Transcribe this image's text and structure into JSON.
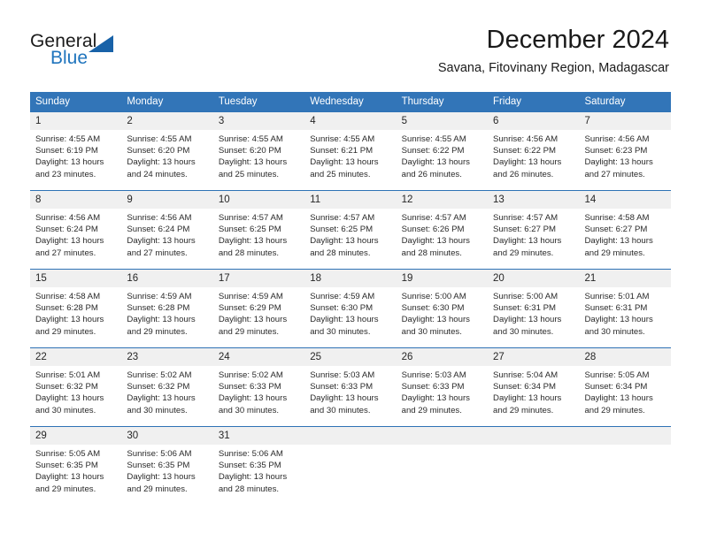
{
  "brand": {
    "name_part1": "General",
    "name_part2": "Blue",
    "triangle_color": "#1862a8",
    "blue_color": "#1f74bd"
  },
  "header": {
    "title": "December 2024",
    "subtitle": "Savana, Fitovinany Region, Madagascar"
  },
  "theme": {
    "header_blue": "#3275b8",
    "row_divider_blue": "#2e72b5",
    "date_band_gray": "#f0f0f0"
  },
  "weekdays": [
    "Sunday",
    "Monday",
    "Tuesday",
    "Wednesday",
    "Thursday",
    "Friday",
    "Saturday"
  ],
  "weeks": [
    {
      "dates": [
        "1",
        "2",
        "3",
        "4",
        "5",
        "6",
        "7"
      ],
      "cells": [
        {
          "sunrise": "Sunrise: 4:55 AM",
          "sunset": "Sunset: 6:19 PM",
          "daylight": "Daylight: 13 hours and 23 minutes."
        },
        {
          "sunrise": "Sunrise: 4:55 AM",
          "sunset": "Sunset: 6:20 PM",
          "daylight": "Daylight: 13 hours and 24 minutes."
        },
        {
          "sunrise": "Sunrise: 4:55 AM",
          "sunset": "Sunset: 6:20 PM",
          "daylight": "Daylight: 13 hours and 25 minutes."
        },
        {
          "sunrise": "Sunrise: 4:55 AM",
          "sunset": "Sunset: 6:21 PM",
          "daylight": "Daylight: 13 hours and 25 minutes."
        },
        {
          "sunrise": "Sunrise: 4:55 AM",
          "sunset": "Sunset: 6:22 PM",
          "daylight": "Daylight: 13 hours and 26 minutes."
        },
        {
          "sunrise": "Sunrise: 4:56 AM",
          "sunset": "Sunset: 6:22 PM",
          "daylight": "Daylight: 13 hours and 26 minutes."
        },
        {
          "sunrise": "Sunrise: 4:56 AM",
          "sunset": "Sunset: 6:23 PM",
          "daylight": "Daylight: 13 hours and 27 minutes."
        }
      ]
    },
    {
      "dates": [
        "8",
        "9",
        "10",
        "11",
        "12",
        "13",
        "14"
      ],
      "cells": [
        {
          "sunrise": "Sunrise: 4:56 AM",
          "sunset": "Sunset: 6:24 PM",
          "daylight": "Daylight: 13 hours and 27 minutes."
        },
        {
          "sunrise": "Sunrise: 4:56 AM",
          "sunset": "Sunset: 6:24 PM",
          "daylight": "Daylight: 13 hours and 27 minutes."
        },
        {
          "sunrise": "Sunrise: 4:57 AM",
          "sunset": "Sunset: 6:25 PM",
          "daylight": "Daylight: 13 hours and 28 minutes."
        },
        {
          "sunrise": "Sunrise: 4:57 AM",
          "sunset": "Sunset: 6:25 PM",
          "daylight": "Daylight: 13 hours and 28 minutes."
        },
        {
          "sunrise": "Sunrise: 4:57 AM",
          "sunset": "Sunset: 6:26 PM",
          "daylight": "Daylight: 13 hours and 28 minutes."
        },
        {
          "sunrise": "Sunrise: 4:57 AM",
          "sunset": "Sunset: 6:27 PM",
          "daylight": "Daylight: 13 hours and 29 minutes."
        },
        {
          "sunrise": "Sunrise: 4:58 AM",
          "sunset": "Sunset: 6:27 PM",
          "daylight": "Daylight: 13 hours and 29 minutes."
        }
      ]
    },
    {
      "dates": [
        "15",
        "16",
        "17",
        "18",
        "19",
        "20",
        "21"
      ],
      "cells": [
        {
          "sunrise": "Sunrise: 4:58 AM",
          "sunset": "Sunset: 6:28 PM",
          "daylight": "Daylight: 13 hours and 29 minutes."
        },
        {
          "sunrise": "Sunrise: 4:59 AM",
          "sunset": "Sunset: 6:28 PM",
          "daylight": "Daylight: 13 hours and 29 minutes."
        },
        {
          "sunrise": "Sunrise: 4:59 AM",
          "sunset": "Sunset: 6:29 PM",
          "daylight": "Daylight: 13 hours and 29 minutes."
        },
        {
          "sunrise": "Sunrise: 4:59 AM",
          "sunset": "Sunset: 6:30 PM",
          "daylight": "Daylight: 13 hours and 30 minutes."
        },
        {
          "sunrise": "Sunrise: 5:00 AM",
          "sunset": "Sunset: 6:30 PM",
          "daylight": "Daylight: 13 hours and 30 minutes."
        },
        {
          "sunrise": "Sunrise: 5:00 AM",
          "sunset": "Sunset: 6:31 PM",
          "daylight": "Daylight: 13 hours and 30 minutes."
        },
        {
          "sunrise": "Sunrise: 5:01 AM",
          "sunset": "Sunset: 6:31 PM",
          "daylight": "Daylight: 13 hours and 30 minutes."
        }
      ]
    },
    {
      "dates": [
        "22",
        "23",
        "24",
        "25",
        "26",
        "27",
        "28"
      ],
      "cells": [
        {
          "sunrise": "Sunrise: 5:01 AM",
          "sunset": "Sunset: 6:32 PM",
          "daylight": "Daylight: 13 hours and 30 minutes."
        },
        {
          "sunrise": "Sunrise: 5:02 AM",
          "sunset": "Sunset: 6:32 PM",
          "daylight": "Daylight: 13 hours and 30 minutes."
        },
        {
          "sunrise": "Sunrise: 5:02 AM",
          "sunset": "Sunset: 6:33 PM",
          "daylight": "Daylight: 13 hours and 30 minutes."
        },
        {
          "sunrise": "Sunrise: 5:03 AM",
          "sunset": "Sunset: 6:33 PM",
          "daylight": "Daylight: 13 hours and 30 minutes."
        },
        {
          "sunrise": "Sunrise: 5:03 AM",
          "sunset": "Sunset: 6:33 PM",
          "daylight": "Daylight: 13 hours and 29 minutes."
        },
        {
          "sunrise": "Sunrise: 5:04 AM",
          "sunset": "Sunset: 6:34 PM",
          "daylight": "Daylight: 13 hours and 29 minutes."
        },
        {
          "sunrise": "Sunrise: 5:05 AM",
          "sunset": "Sunset: 6:34 PM",
          "daylight": "Daylight: 13 hours and 29 minutes."
        }
      ]
    },
    {
      "dates": [
        "29",
        "30",
        "31",
        "",
        "",
        "",
        ""
      ],
      "cells": [
        {
          "sunrise": "Sunrise: 5:05 AM",
          "sunset": "Sunset: 6:35 PM",
          "daylight": "Daylight: 13 hours and 29 minutes."
        },
        {
          "sunrise": "Sunrise: 5:06 AM",
          "sunset": "Sunset: 6:35 PM",
          "daylight": "Daylight: 13 hours and 29 minutes."
        },
        {
          "sunrise": "Sunrise: 5:06 AM",
          "sunset": "Sunset: 6:35 PM",
          "daylight": "Daylight: 13 hours and 28 minutes."
        },
        {
          "sunrise": "",
          "sunset": "",
          "daylight": ""
        },
        {
          "sunrise": "",
          "sunset": "",
          "daylight": ""
        },
        {
          "sunrise": "",
          "sunset": "",
          "daylight": ""
        },
        {
          "sunrise": "",
          "sunset": "",
          "daylight": ""
        }
      ]
    }
  ]
}
